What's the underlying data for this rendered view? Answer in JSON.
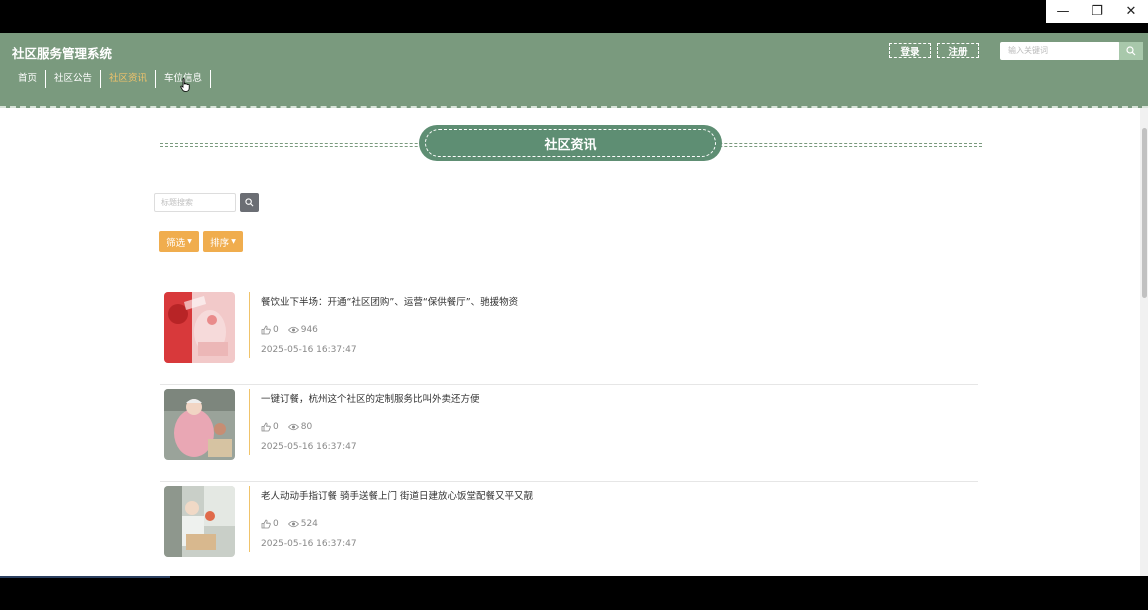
{
  "window": {
    "minimize": "—",
    "restore": "❐",
    "close": "✕"
  },
  "header": {
    "brand": "社区服务管理系统",
    "nav": [
      {
        "label": "首页",
        "active": false
      },
      {
        "label": "社区公告",
        "active": false
      },
      {
        "label": "社区资讯",
        "active": true
      },
      {
        "label": "车位信息",
        "active": false
      }
    ],
    "login_label": "登录",
    "register_label": "注册",
    "search_placeholder": "输入关键词"
  },
  "section": {
    "title": "社区资讯",
    "keyword_placeholder": "标题搜索",
    "filter_label": "筛选",
    "sort_label": "排序"
  },
  "articles": [
    {
      "title": "餐饮业下半场：开通“社区团购”、运营“保供餐厅”、驰援物资",
      "likes": "0",
      "views": "946",
      "date": "2025-05-16 16:37:47"
    },
    {
      "title": "一键订餐，杭州这个社区的定制服务比叫外卖还方便",
      "likes": "0",
      "views": "80",
      "date": "2025-05-16 16:37:47"
    },
    {
      "title": "老人动动手指订餐 骑手送餐上门 街道日建放心饭堂配餐又平又靓",
      "likes": "0",
      "views": "524",
      "date": "2025-05-16 16:37:47"
    }
  ],
  "colors": {
    "header_bg": "#7a9a7e",
    "accent": "#f0ad4e",
    "title_pill": "#5e8e73",
    "active_nav": "#f0c36a"
  }
}
